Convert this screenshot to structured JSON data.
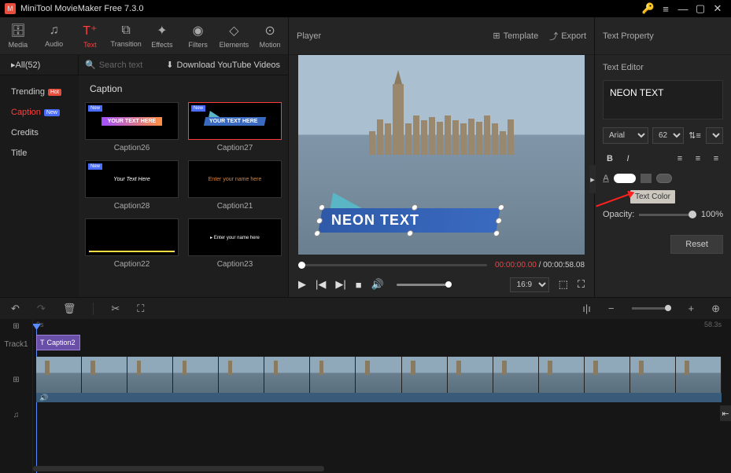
{
  "app": {
    "title": "MiniTool MovieMaker Free 7.3.0"
  },
  "toolbar": [
    {
      "id": "media",
      "label": "Media",
      "iconName": "archive-icon"
    },
    {
      "id": "audio",
      "label": "Audio",
      "iconName": "music-icon"
    },
    {
      "id": "text",
      "label": "Text",
      "iconName": "text-icon",
      "active": true
    },
    {
      "id": "transition",
      "label": "Transition",
      "iconName": "transition-icon"
    },
    {
      "id": "effects",
      "label": "Effects",
      "iconName": "effects-icon"
    },
    {
      "id": "filters",
      "label": "Filters",
      "iconName": "filters-icon"
    },
    {
      "id": "elements",
      "label": "Elements",
      "iconName": "elements-icon"
    },
    {
      "id": "motion",
      "label": "Motion",
      "iconName": "motion-icon"
    }
  ],
  "media": {
    "countLabel": "All(52)",
    "searchPlaceholder": "Search text",
    "downloadLabel": "Download YouTube Videos",
    "categories": [
      {
        "label": "Trending",
        "badge": "Hot",
        "badgeClass": "hot"
      },
      {
        "label": "Caption",
        "badge": "New",
        "badgeClass": "new",
        "active": true
      },
      {
        "label": "Credits"
      },
      {
        "label": "Title"
      }
    ],
    "gridTitle": "Caption",
    "items": [
      {
        "label": "Caption26",
        "new": true,
        "preview": "YOUR TEXT HERE",
        "style": "c26"
      },
      {
        "label": "Caption27",
        "new": true,
        "preview": "YOUR TEXT HERE",
        "style": "c27",
        "selected": true
      },
      {
        "label": "Caption28",
        "new": true,
        "preview": "Your Text Here",
        "style": "c28"
      },
      {
        "label": "Caption21",
        "preview": "Enter your name here",
        "style": "c21"
      },
      {
        "label": "Caption22",
        "preview": "",
        "style": "c22"
      },
      {
        "label": "Caption23",
        "preview": "Enter your name here",
        "style": "c23"
      }
    ]
  },
  "player": {
    "title": "Player",
    "templateLabel": "Template",
    "exportLabel": "Export",
    "overlayText": "NEON TEXT",
    "currentTime": "00:00:00.00",
    "duration": "00:00:58.08",
    "aspect": "16:9"
  },
  "property": {
    "title": "Text Property",
    "subTitle": "Text Editor",
    "textValue": "NEON TEXT",
    "font": "Arial",
    "fontSize": "62",
    "tooltip": "Text Color",
    "opacityLabel": "Opacity:",
    "opacityValue": "100%",
    "resetLabel": "Reset"
  },
  "timeline": {
    "startTime": "0s",
    "endTime": "58.3s",
    "track1Label": "Track1",
    "captionClipLabel": "Caption2"
  }
}
